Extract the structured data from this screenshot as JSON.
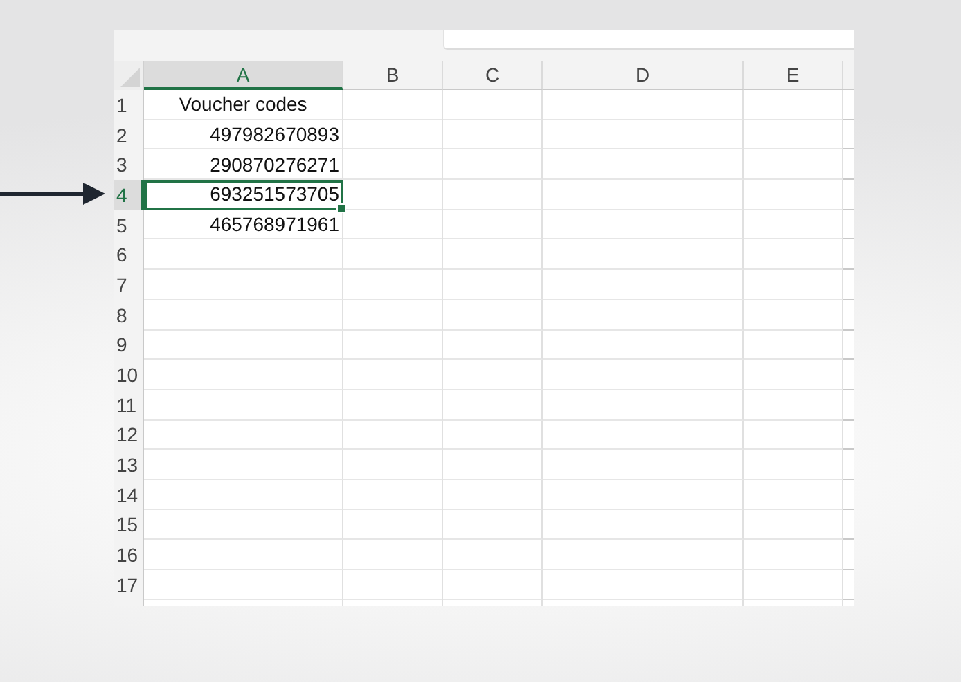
{
  "columns": [
    {
      "label": "A",
      "selected": true
    },
    {
      "label": "B",
      "selected": false
    },
    {
      "label": "C",
      "selected": false
    },
    {
      "label": "D",
      "selected": false
    },
    {
      "label": "E",
      "selected": false
    }
  ],
  "rows": [
    {
      "number": "1",
      "selected": false,
      "cells": [
        {
          "kind": "text",
          "text": "Voucher codes"
        }
      ]
    },
    {
      "number": "2",
      "selected": false,
      "cells": [
        {
          "kind": "number",
          "text": "497982670893"
        }
      ]
    },
    {
      "number": "3",
      "selected": false,
      "cells": [
        {
          "kind": "number",
          "text": "290870276271"
        }
      ]
    },
    {
      "number": "4",
      "selected": true,
      "cells": [
        {
          "kind": "number",
          "text": "693251573705"
        }
      ]
    },
    {
      "number": "5",
      "selected": false,
      "cells": [
        {
          "kind": "number",
          "text": "465768971961"
        }
      ]
    },
    {
      "number": "6",
      "selected": false
    },
    {
      "number": "7",
      "selected": false
    },
    {
      "number": "8",
      "selected": false
    },
    {
      "number": "9",
      "selected": false
    },
    {
      "number": "10",
      "selected": false
    },
    {
      "number": "11",
      "selected": false
    },
    {
      "number": "12",
      "selected": false
    },
    {
      "number": "13",
      "selected": false
    },
    {
      "number": "14",
      "selected": false
    },
    {
      "number": "15",
      "selected": false
    },
    {
      "number": "16",
      "selected": false
    },
    {
      "number": "17",
      "selected": false
    }
  ]
}
